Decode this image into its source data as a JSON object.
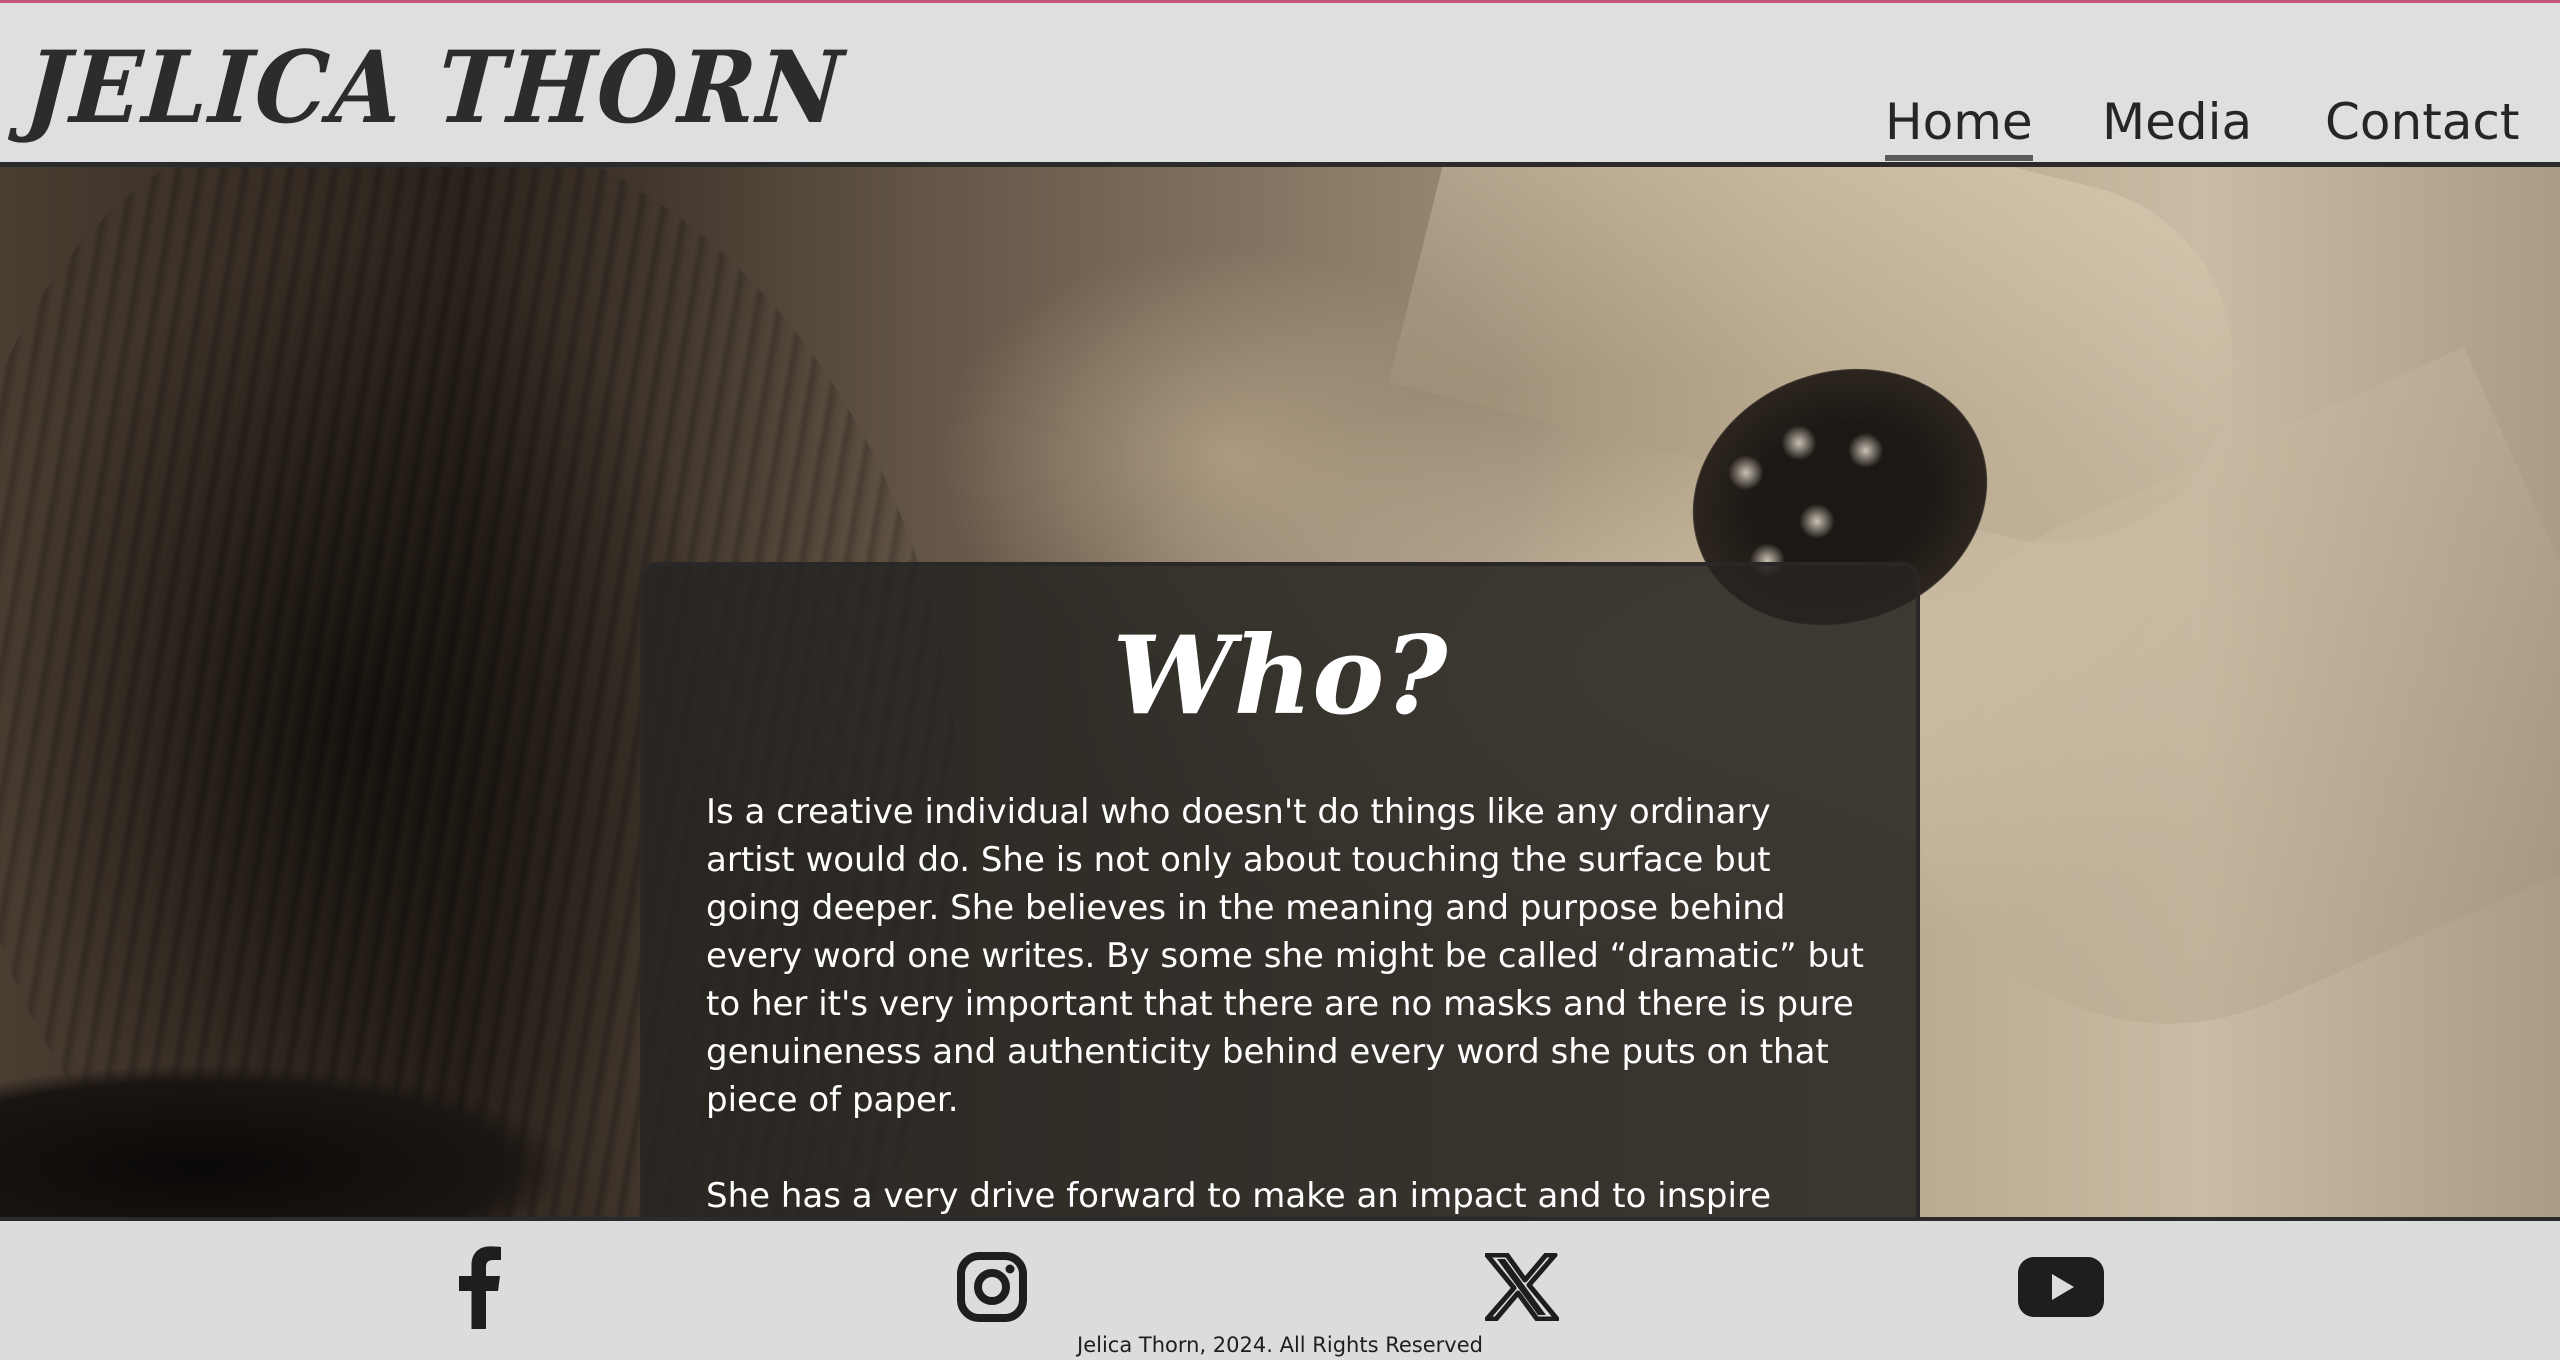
{
  "site": {
    "logo": "JELICA THORN"
  },
  "nav": {
    "items": [
      {
        "label": "Home",
        "active": true
      },
      {
        "label": "Media",
        "active": false
      },
      {
        "label": "Contact",
        "active": false
      }
    ]
  },
  "main": {
    "title": "Who?",
    "paragraphs": [
      "Is a creative individual who doesn't do things like any ordinary artist would do. She is not only about touching the surface but going deeper. She believes in the meaning and purpose behind every word one writes. By some she might be called “dramatic” but to her it's very important that there are no masks and there is pure genuineness and authenticity behind every word she puts on that piece of paper.",
      "She has a very drive forward to make an impact and to inspire people out there, especially young girls but also young people in general to"
    ]
  },
  "footer": {
    "social": [
      {
        "icon": "facebook-icon"
      },
      {
        "icon": "instagram-icon"
      },
      {
        "icon": "x-twitter-icon"
      },
      {
        "icon": "youtube-icon"
      }
    ],
    "copyright": "Jelica Thorn, 2024. All Rights Reserved"
  },
  "colors": {
    "header_bg": "#dfdfdf",
    "accent_top_border": "#c2567f",
    "text_dark": "#262626",
    "card_bg": "#262421",
    "footer_bg": "#dcdcdc"
  }
}
